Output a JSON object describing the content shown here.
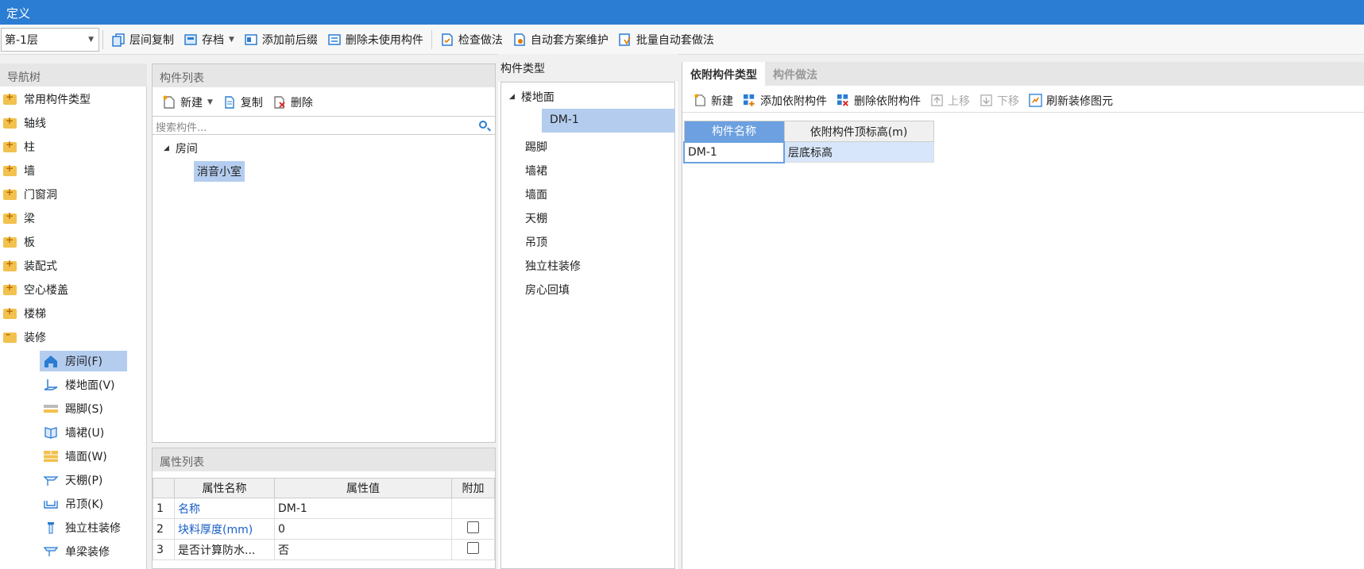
{
  "window": {
    "title": "定义"
  },
  "toolbar": {
    "floor": "第-1层",
    "buttons": [
      "层间复制",
      "存档",
      "添加前后缀",
      "删除未使用构件",
      "检查做法",
      "自动套方案维护",
      "批量自动套做法"
    ]
  },
  "nav": {
    "title": "导航树",
    "items": [
      "常用构件类型",
      "轴线",
      "柱",
      "墙",
      "门窗洞",
      "梁",
      "板",
      "装配式",
      "空心楼盖",
      "楼梯",
      "装修"
    ],
    "sub_items": [
      "房间(F)",
      "楼地面(V)",
      "踢脚(S)",
      "墙裙(U)",
      "墙面(W)",
      "天棚(P)",
      "吊顶(K)",
      "独立柱装修",
      "单梁装修"
    ]
  },
  "complist": {
    "title": "构件列表",
    "new": "新建",
    "copy": "复制",
    "delete": "删除",
    "search_placeholder": "搜索构件...",
    "root": "房间",
    "child": "消音小室"
  },
  "props": {
    "title": "属性列表",
    "headers": [
      "属性名称",
      "属性值",
      "附加"
    ],
    "rows": [
      {
        "no": "1",
        "name": "名称",
        "value": "DM-1"
      },
      {
        "no": "2",
        "name": "块料厚度(mm)",
        "value": "0"
      },
      {
        "no": "3",
        "name": "是否计算防水...",
        "value": "否"
      }
    ]
  },
  "ctype": {
    "title": "构件类型",
    "root": "楼地面",
    "selected": "DM-1",
    "items": [
      "踢脚",
      "墙裙",
      "墙面",
      "天棚",
      "吊顶",
      "独立柱装修",
      "房心回填"
    ]
  },
  "right": {
    "tabs": [
      "依附构件类型",
      "构件做法"
    ],
    "toolbar": [
      "新建",
      "添加依附构件",
      "删除依附构件",
      "上移",
      "下移",
      "刷新装修图元"
    ],
    "headers": [
      "构件名称",
      "依附构件顶标高(m)"
    ],
    "row": {
      "name": "DM-1",
      "elev": "层底标高"
    }
  },
  "colors": {
    "titlebar": "#2b7cd3",
    "selection": "#b4cdef",
    "link": "#1a5fc8"
  }
}
